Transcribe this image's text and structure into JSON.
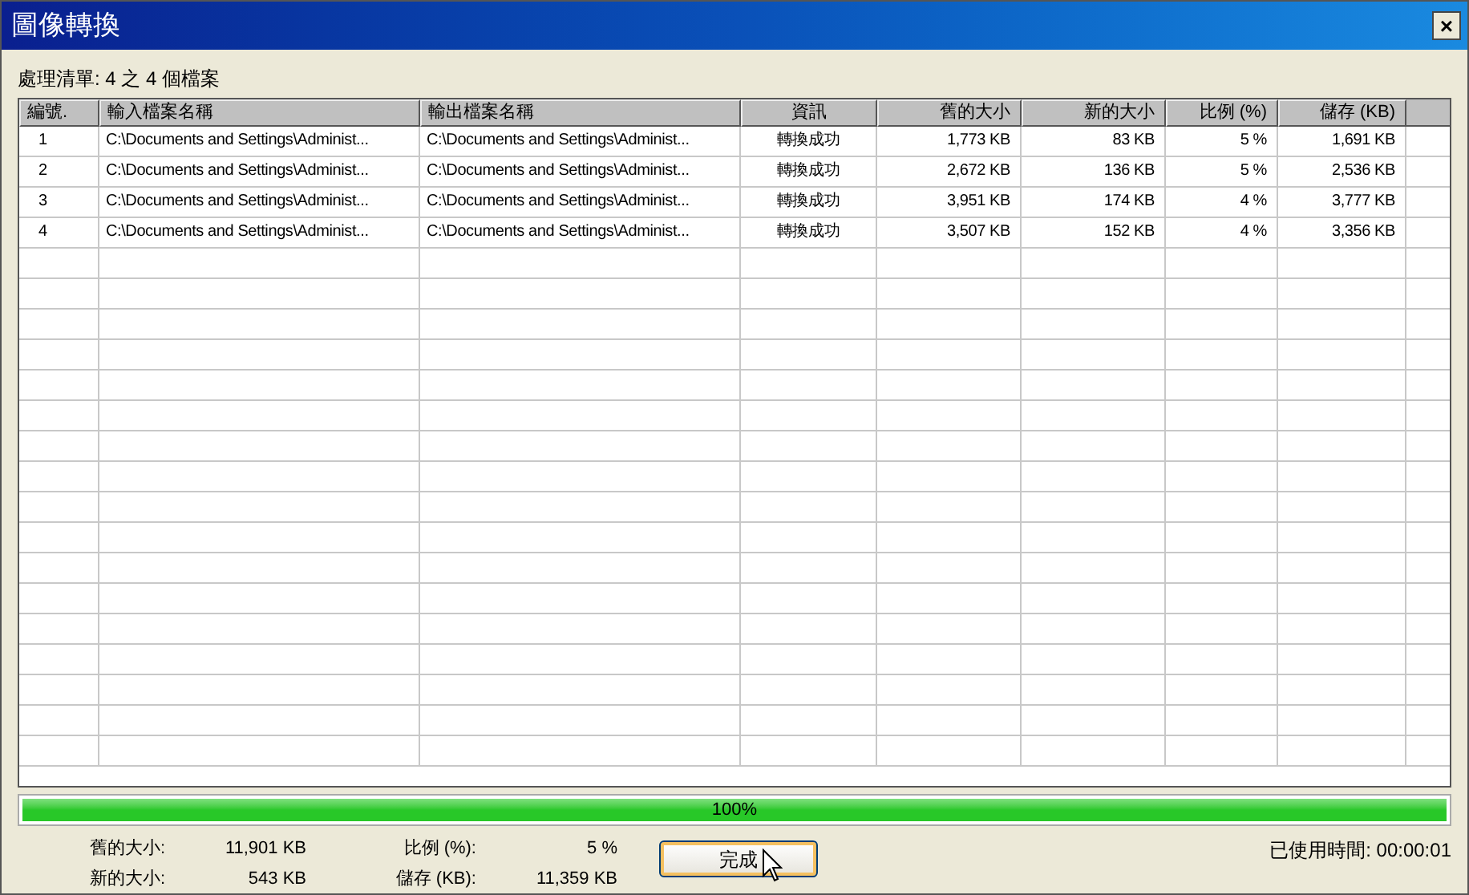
{
  "window": {
    "title": "圖像轉換",
    "close": "×"
  },
  "list_label": "處理清單: 4 之 4 個檔案",
  "table": {
    "columns": [
      "編號.",
      "輸入檔案名稱",
      "輸出檔案名稱",
      "資訊",
      "舊的大小",
      "新的大小",
      "比例 (%)",
      "儲存 (KB)"
    ],
    "rows": [
      [
        "1",
        "C:\\Documents and Settings\\Administ...",
        "C:\\Documents and Settings\\Administ...",
        "轉換成功",
        "1,773 KB",
        "83 KB",
        "5 %",
        "1,691 KB"
      ],
      [
        "2",
        "C:\\Documents and Settings\\Administ...",
        "C:\\Documents and Settings\\Administ...",
        "轉換成功",
        "2,672 KB",
        "136 KB",
        "5 %",
        "2,536 KB"
      ],
      [
        "3",
        "C:\\Documents and Settings\\Administ...",
        "C:\\Documents and Settings\\Administ...",
        "轉換成功",
        "3,951 KB",
        "174 KB",
        "4 %",
        "3,777 KB"
      ],
      [
        "4",
        "C:\\Documents and Settings\\Administ...",
        "C:\\Documents and Settings\\Administ...",
        "轉換成功",
        "3,507 KB",
        "152 KB",
        "4 %",
        "3,356 KB"
      ]
    ]
  },
  "progress": {
    "level": 1,
    "text": "100%"
  },
  "summary": [
    {
      "label": "舊的大小:",
      "value": "11,901 KB"
    },
    {
      "label": "新的大小:",
      "value": "543 KB"
    },
    {
      "label": "比例 (%):",
      "value": "5 %"
    },
    {
      "label": "儲存 (KB):",
      "value": "11,359 KB"
    }
  ],
  "done_button": "完成",
  "elapsed": {
    "label": "已使用時間:",
    "value": "00:00:01"
  }
}
